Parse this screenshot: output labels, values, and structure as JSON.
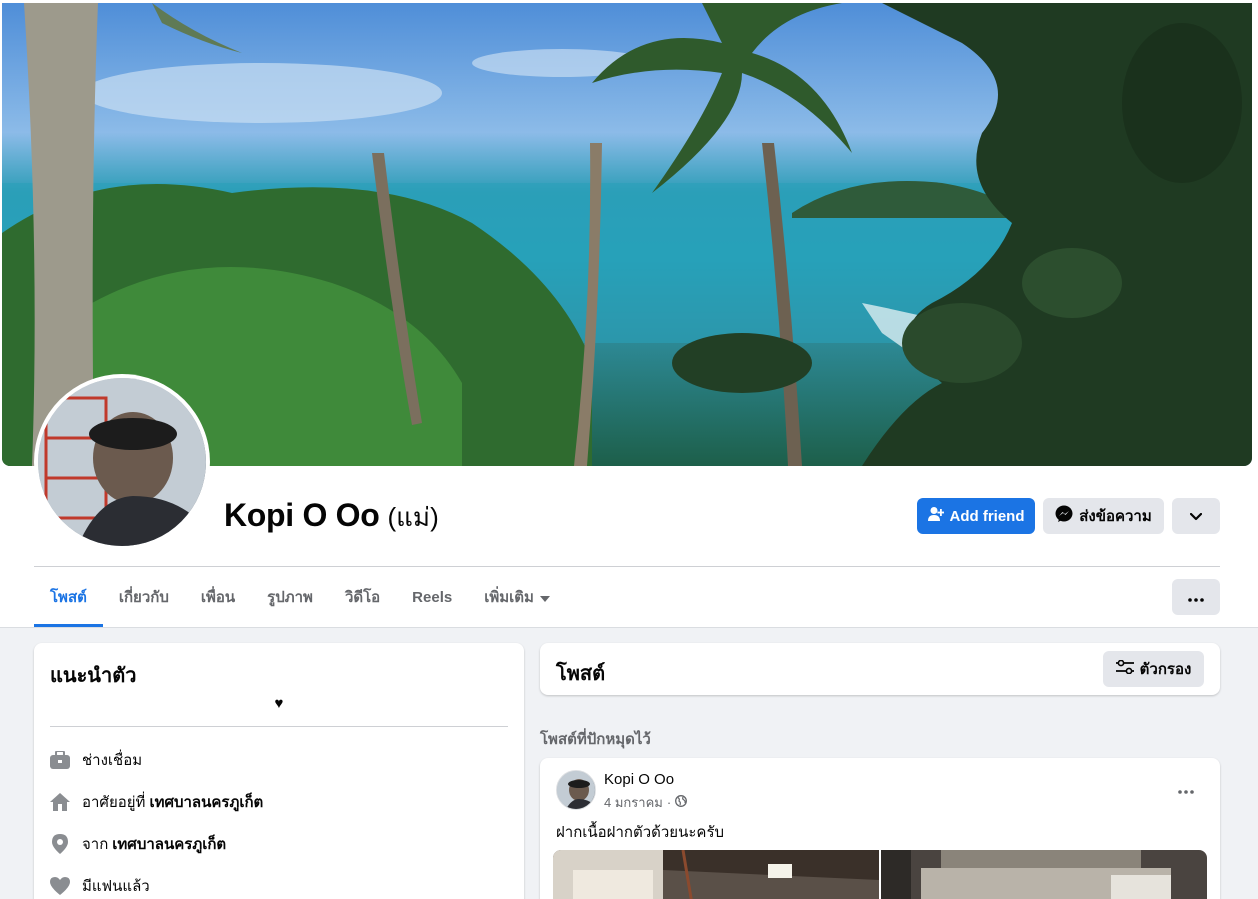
{
  "profile": {
    "name": "Kopi O Oo",
    "alternate_name": "(แม่)"
  },
  "actions": {
    "add_friend": "Add friend",
    "message": "ส่งข้อความ"
  },
  "tabs": [
    {
      "label": "โพสต์",
      "active": true
    },
    {
      "label": "เกี่ยวกับ"
    },
    {
      "label": "เพื่อน"
    },
    {
      "label": "รูปภาพ"
    },
    {
      "label": "วิดีโอ"
    },
    {
      "label": "Reels"
    },
    {
      "label": "เพิ่มเติม"
    }
  ],
  "intro": {
    "title": "แนะนำตัว",
    "bio": "♥",
    "items": [
      {
        "icon": "briefcase-icon",
        "text": "ช่างเชื่อม",
        "bold": ""
      },
      {
        "icon": "home-icon",
        "text": "อาศัยอยู่ที่",
        "bold": "เทศบาลนครภูเก็ต"
      },
      {
        "icon": "location-pin-icon",
        "text": "จาก",
        "bold": "เทศบาลนครภูเก็ต"
      },
      {
        "icon": "heart-icon",
        "text": "มีแฟนแล้ว",
        "bold": ""
      }
    ]
  },
  "posts": {
    "title": "โพสต์",
    "filter_label": "ตัวกรอง",
    "pinned_label": "โพสต์ที่ปักหมุดไว้",
    "pinned_post": {
      "author": "Kopi O Oo",
      "date": "4 มกราคม",
      "separator": "·",
      "text": "ฝากเนื้อฝากตัวด้วยนะครับ"
    }
  },
  "colors": {
    "accent": "#1b74e4",
    "page_bg": "#f0f2f5",
    "secondary_btn": "#e4e6eb"
  }
}
